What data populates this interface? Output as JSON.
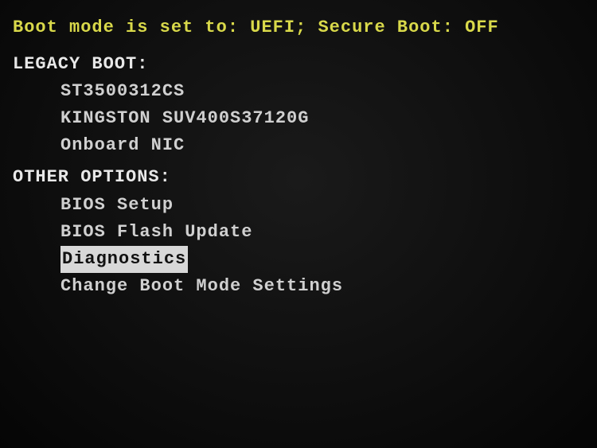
{
  "status": {
    "prefix": "Boot mode is set to:",
    "mode": "UEFI",
    "secure_boot_label": "Secure Boot:",
    "secure_boot_state": "OFF"
  },
  "sections": {
    "legacy_boot": {
      "header": "LEGACY BOOT:",
      "items": [
        "ST3500312CS",
        "KINGSTON SUV400S37120G",
        "Onboard NIC"
      ]
    },
    "other_options": {
      "header": "OTHER OPTIONS:",
      "items": [
        "BIOS Setup",
        "BIOS Flash Update",
        "Diagnostics",
        "Change Boot Mode Settings"
      ],
      "selected_index": 2
    }
  }
}
